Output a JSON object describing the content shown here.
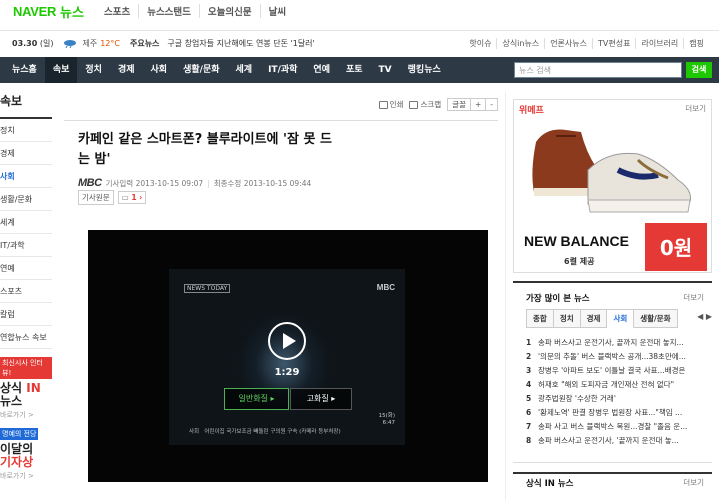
{
  "header": {
    "logo": "NAVER",
    "section": "뉴스",
    "nav": [
      "스포츠",
      "뉴스스탠드",
      "오늘의신문",
      "날씨"
    ]
  },
  "infobar": {
    "date": "03.30",
    "day": "(일)",
    "region": "제주",
    "temp": "12°C",
    "major_label": "주요뉴스",
    "headline": "구글 창업자들 지난해에도 연봉 단돈 '1달러'",
    "links": [
      "핫이슈",
      "상식in뉴스",
      "언론사뉴스",
      "TV편성표",
      "라이브러리",
      "캠핑"
    ]
  },
  "mainnav": {
    "items": [
      "뉴스홈",
      "속보",
      "정치",
      "경제",
      "사회",
      "생활/문화",
      "세계",
      "IT/과학",
      "연예",
      "포토",
      "TV",
      "랭킹뉴스"
    ],
    "active_index": 1,
    "search_placeholder": "뉴스 검색",
    "search_button": "검색"
  },
  "sidebar": {
    "title": "속보",
    "items": [
      "정치",
      "경제",
      "사회",
      "생활/문화",
      "세계",
      "IT/과학",
      "연예",
      "스포츠",
      "칼럼",
      "연합뉴스 속보"
    ],
    "active_index": 2,
    "promo1": {
      "label": "최신시사 인터뷰!",
      "line1": "상식",
      "line1_em": "IN",
      "line2": "뉴스",
      "more": "바로가기 >"
    },
    "promo2": {
      "label": "명예의 전당",
      "line1": "이달의",
      "line2": "기자상",
      "more": "바로가기 >"
    }
  },
  "toolbar": {
    "print": "인쇄",
    "scrap": "스크랩",
    "font": "글꼴",
    "plus": "+",
    "minus": "-"
  },
  "article": {
    "title": "카페인 같은 스마트폰? 블루라이트에 '잠 못 드는 밤'",
    "press": "MBC",
    "input_label": "기사입력",
    "input_time": "2013-10-15 09:07",
    "edit_label": "최종수정",
    "edit_time": "2013-10-15 09:44",
    "original_btn": "기사원문",
    "comment_count": "1"
  },
  "video": {
    "news_tag": "NEWS TODAY",
    "channel": "MBC",
    "duration": "1:29",
    "quality_low": "일반화질 ▸",
    "quality_high": "고화질 ▸",
    "caption_left": "사회",
    "caption": "어린이집 국가보조금 빼돌린 구의원 구속 (카메라 등부처장)",
    "time1": "15(화)",
    "time2": "6:47"
  },
  "ad": {
    "label": "위메프",
    "more": "더보기",
    "brand": "NEW BALANCE",
    "sub": "6켤 제공",
    "price": "0",
    "price_unit": "원"
  },
  "ranking": {
    "title": "가장 많이 본 뉴스",
    "more": "더보기",
    "tabs": [
      "종합",
      "정치",
      "경제",
      "사회",
      "생활/문화"
    ],
    "active_tab": 3,
    "arrows": "◀ ▶",
    "items": [
      "송파 버스사고 운전기사, 끝까지 운전대 놓지...",
      "'의문의 추돌' 버스 블랙박스 공개...38초만에...",
      "장병우 '아파트 보도' 이틀날 결국 사표...배경은",
      "허재호 \"해외 도피자금 개인재산 전혀 없다\"",
      "광주법원장 '수상한 거래'",
      "'황제노역' 판결 장병우 법원장 사표...\"책임 ...",
      "송파 사고 버스 블랙박스 복원...경찰 \"졸음 운...",
      "송파 버스사고 운전기사, '끝까지 운전대 놓..."
    ]
  },
  "next_box": {
    "title": "상식 IN 뉴스",
    "more": "더보기"
  }
}
